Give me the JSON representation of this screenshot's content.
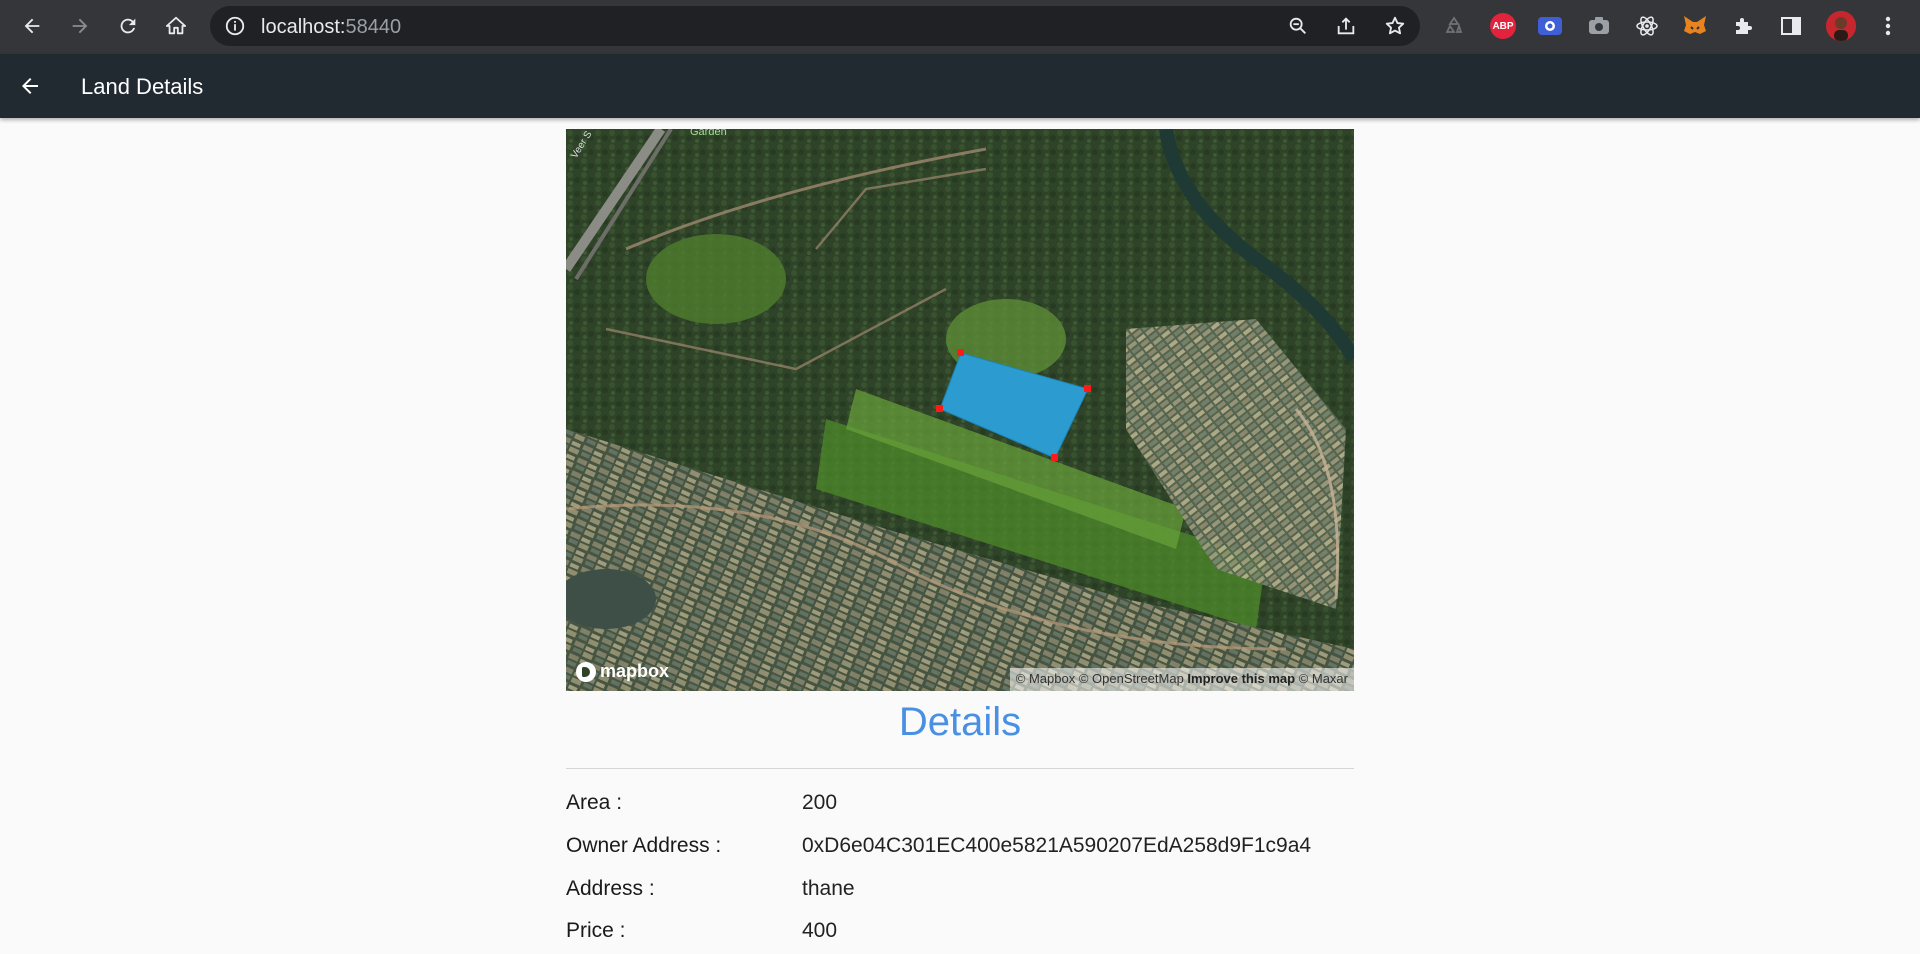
{
  "browser": {
    "url_host": "localhost:",
    "url_port": "58440"
  },
  "app_bar": {
    "title": "Land Details"
  },
  "map": {
    "labels": {
      "road": "Veer S",
      "garden": "Garden"
    },
    "logo_text": "mapbox",
    "attribution": {
      "mapbox": "© Mapbox",
      "osm": "© OpenStreetMap",
      "improve": "Improve this map",
      "maxar": "© Maxar"
    },
    "polygon_fill": "#2b9bd0",
    "vertex_color": "#ff1a1a"
  },
  "details": {
    "heading": "Details",
    "rows": [
      {
        "label": "Area :",
        "value": "200"
      },
      {
        "label": "Owner Address :",
        "value": "0xD6e04C301EC400e5821A590207EdA258d9F1c9a4"
      },
      {
        "label": "Address :",
        "value": "thane"
      },
      {
        "label": "Price :",
        "value": "400"
      }
    ]
  },
  "colors": {
    "accent": "#4a90e2",
    "app_bar": "#212a31",
    "browser_bar": "#35363a"
  }
}
